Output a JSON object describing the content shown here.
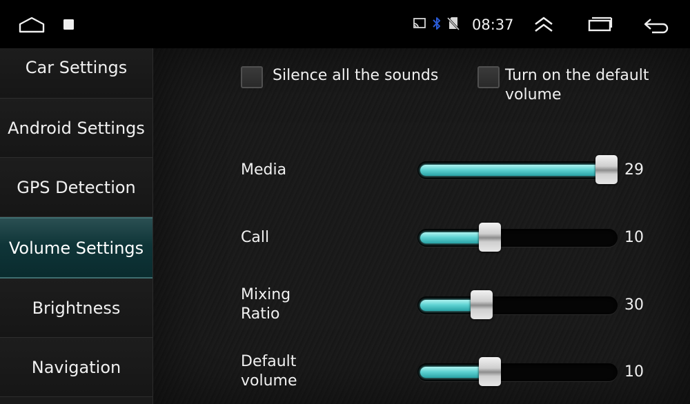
{
  "status_bar": {
    "time": "08:37",
    "icons": [
      "home-icon",
      "square-icon",
      "cast-icon",
      "bluetooth-icon",
      "no-sim-icon",
      "chevron-up-icon",
      "recent-apps-icon",
      "back-icon"
    ],
    "bluetooth_color": "#2a5bd7"
  },
  "sidebar": {
    "items": [
      {
        "label": "Car Settings",
        "active": false
      },
      {
        "label": "Android Settings",
        "active": false
      },
      {
        "label": "GPS Detection",
        "active": false
      },
      {
        "label": "Volume Settings",
        "active": true
      },
      {
        "label": "Brightness",
        "active": false
      },
      {
        "label": "Navigation",
        "active": false
      }
    ],
    "active_color": "#0f3538"
  },
  "main": {
    "checkboxes": {
      "silence": {
        "label": "Silence all the sounds",
        "checked": false
      },
      "default_volume": {
        "label": "Turn on the default volume",
        "checked": false
      }
    },
    "sliders": [
      {
        "label": "Media",
        "value": "29",
        "level": 1.0
      },
      {
        "label": "Call",
        "value": "10",
        "level": 0.345
      },
      {
        "label": "Mixing Ratio",
        "value": "30",
        "level": 0.3
      },
      {
        "label": "Default volume",
        "value": "10",
        "level": 0.345
      }
    ],
    "slider_fill_color": "#5fd3d3"
  }
}
